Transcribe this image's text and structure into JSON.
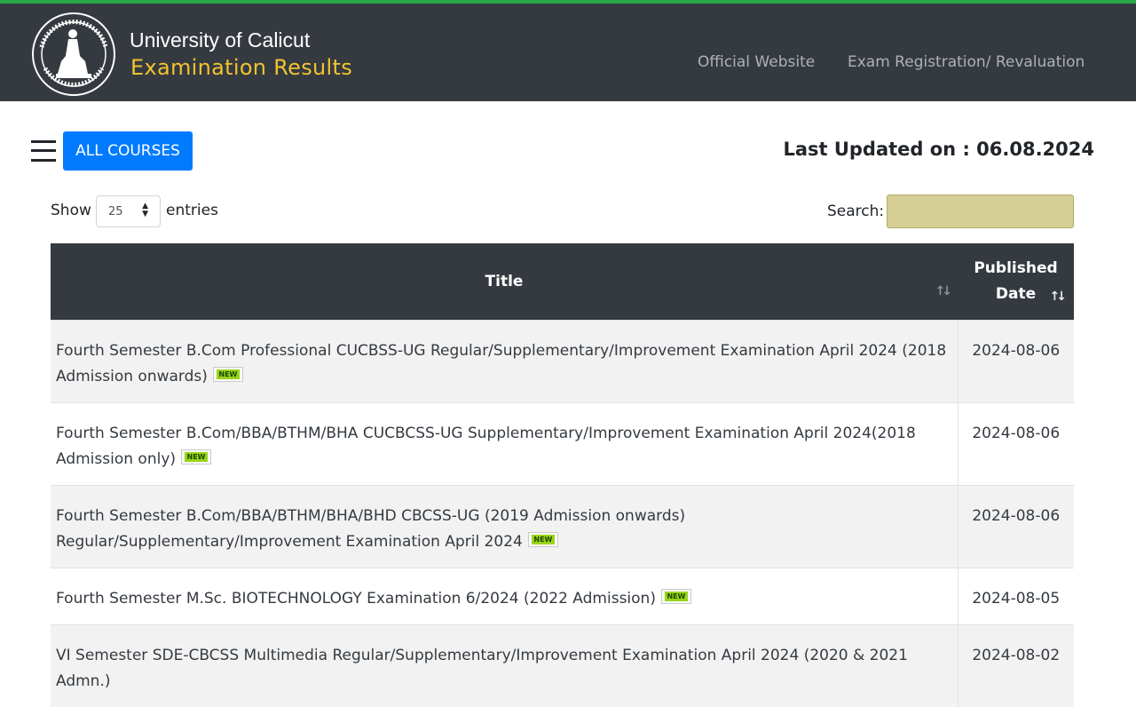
{
  "header": {
    "title": "University of Calicut",
    "subtitle": "Examination Results",
    "nav": [
      {
        "label": "Official Website"
      },
      {
        "label": "Exam Registration/ Revaluation"
      }
    ]
  },
  "toolbar": {
    "all_courses_label": "ALL COURSES",
    "last_updated": "Last Updated on : 06.08.2024"
  },
  "controls": {
    "show_label": "Show",
    "entries_value": "25",
    "entries_label": "entries",
    "search_label": "Search:",
    "search_value": ""
  },
  "table": {
    "columns": [
      "Title",
      "Published Date"
    ],
    "rows": [
      {
        "title": "Fourth Semester B.Com Professional CUCBSS-UG Regular/Supplementary/Improvement Examination April 2024 (2018 Admission onwards)",
        "date": "2024-08-06",
        "badge": "NEW"
      },
      {
        "title": "Fourth Semester B.Com/BBA/BTHM/BHA CUCBCSS-UG Supplementary/Improvement Examination April 2024(2018 Admission only)",
        "date": "2024-08-06",
        "badge": "NEW"
      },
      {
        "title": "Fourth Semester B.Com/BBA/BTHM/BHA/BHD CBCSS-UG (2019 Admission onwards) Regular/Supplementary/Improvement Examination April 2024",
        "date": "2024-08-06",
        "badge": "NEW"
      },
      {
        "title": "Fourth Semester M.Sc. BIOTECHNOLOGY Examination 6/2024 (2022 Admission)",
        "date": "2024-08-05",
        "badge": "NEW"
      },
      {
        "title": "VI Semester SDE-CBCSS Multimedia Regular/Supplementary/Improvement Examination April 2024 (2020 & 2021 Admn.)",
        "date": "2024-08-02",
        "badge": ""
      }
    ]
  },
  "colors": {
    "navbar": "#343a40",
    "top_strip": "#28a745",
    "brand_subtitle": "#f2c230",
    "primary_button": "#007bff",
    "search_fill": "#d5cf95",
    "new_badge": "#99d41a"
  },
  "icons": [
    "university-logo-icon",
    "hamburger-menu-icon",
    "sort-icon",
    "select-arrows-icon",
    "new-badge-icon"
  ]
}
